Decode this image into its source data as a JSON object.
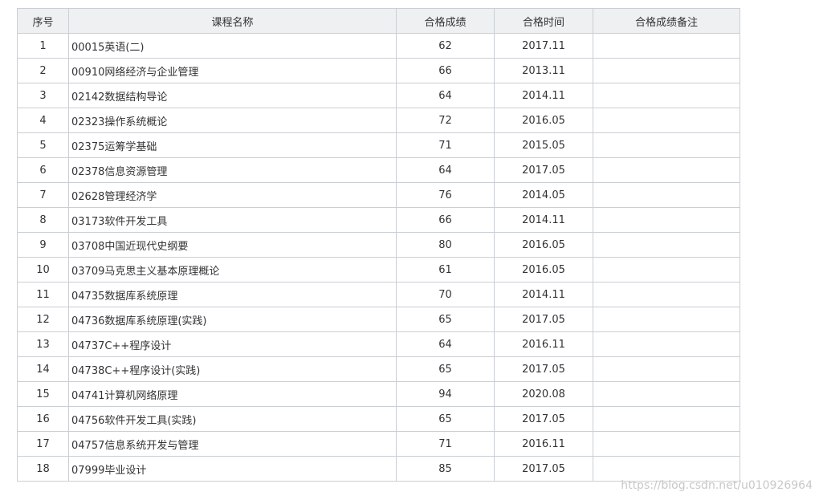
{
  "table": {
    "headers": [
      "序号",
      "课程名称",
      "合格成绩",
      "合格时间",
      "合格成绩备注"
    ],
    "rows": [
      {
        "no": "1",
        "course": "00015英语(二)",
        "score": "62",
        "date": "2017.11",
        "note": ""
      },
      {
        "no": "2",
        "course": "00910网络经济与企业管理",
        "score": "66",
        "date": "2013.11",
        "note": ""
      },
      {
        "no": "3",
        "course": "02142数据结构导论",
        "score": "64",
        "date": "2014.11",
        "note": ""
      },
      {
        "no": "4",
        "course": "02323操作系统概论",
        "score": "72",
        "date": "2016.05",
        "note": ""
      },
      {
        "no": "5",
        "course": "02375运筹学基础",
        "score": "71",
        "date": "2015.05",
        "note": ""
      },
      {
        "no": "6",
        "course": "02378信息资源管理",
        "score": "64",
        "date": "2017.05",
        "note": ""
      },
      {
        "no": "7",
        "course": "02628管理经济学",
        "score": "76",
        "date": "2014.05",
        "note": ""
      },
      {
        "no": "8",
        "course": "03173软件开发工具",
        "score": "66",
        "date": "2014.11",
        "note": ""
      },
      {
        "no": "9",
        "course": "03708中国近现代史纲要",
        "score": "80",
        "date": "2016.05",
        "note": ""
      },
      {
        "no": "10",
        "course": "03709马克思主义基本原理概论",
        "score": "61",
        "date": "2016.05",
        "note": ""
      },
      {
        "no": "11",
        "course": "04735数据库系统原理",
        "score": "70",
        "date": "2014.11",
        "note": ""
      },
      {
        "no": "12",
        "course": "04736数据库系统原理(实践)",
        "score": "65",
        "date": "2017.05",
        "note": ""
      },
      {
        "no": "13",
        "course": "04737C++程序设计",
        "score": "64",
        "date": "2016.11",
        "note": ""
      },
      {
        "no": "14",
        "course": "04738C++程序设计(实践)",
        "score": "65",
        "date": "2017.05",
        "note": ""
      },
      {
        "no": "15",
        "course": "04741计算机网络原理",
        "score": "94",
        "date": "2020.08",
        "note": ""
      },
      {
        "no": "16",
        "course": "04756软件开发工具(实践)",
        "score": "65",
        "date": "2017.05",
        "note": ""
      },
      {
        "no": "17",
        "course": "04757信息系统开发与管理",
        "score": "71",
        "date": "2016.11",
        "note": ""
      },
      {
        "no": "18",
        "course": "07999毕业设计",
        "score": "85",
        "date": "2017.05",
        "note": ""
      }
    ]
  },
  "watermark": "https://blog.csdn.net/u010926964"
}
